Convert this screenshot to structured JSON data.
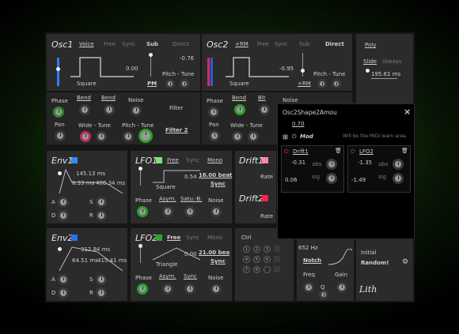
{
  "osc1": {
    "title": "Osc1",
    "voice": "Voice",
    "free": "Free",
    "sync": "Sync",
    "sub": "Sub",
    "direct": "Direct",
    "wave": "Square",
    "val": "0.00",
    "tune": "-0.76",
    "pitch_tune": "Pitch - Tune",
    "pm": "PM",
    "phase": "Phase",
    "bend1": "Bend",
    "bend2": "Bend",
    "noise": "Noise",
    "pan": "Pan",
    "wide_tune": "Wide - Tune",
    "pitch_tune2": "Pitch - Tune",
    "filter": "Filter",
    "filter2": "Filter 2"
  },
  "osc2": {
    "title": "Osc2",
    "rm": "+RM",
    "free": "Free",
    "sync": "Sync",
    "sub": "Sub",
    "direct": "Direct",
    "wave": "Square",
    "val": "-0.95",
    "pitch_tune": "Pitch - Tune",
    "rm2": "+RM",
    "phase": "Phase",
    "bend": "Bend",
    "bit": "Bit",
    "noise": "Noise",
    "pan": "Pan",
    "wide_tune": "Wide - Tune"
  },
  "poly": {
    "poly": "Poly",
    "slide": "Slide",
    "always": "Always",
    "time": "195.61 ms"
  },
  "env1": {
    "title": "Env1",
    "a_time": "145.13 ms",
    "d_time": "8.33 ms",
    "r_time": "406.34 ms",
    "a": "A",
    "s": "S",
    "d": "D",
    "r": "R"
  },
  "env2": {
    "title": "Env2",
    "a_time": "312.84 ms",
    "d_time": "64.51 ms",
    "r_time": "415.41 ms",
    "a": "A",
    "s": "S",
    "d": "D",
    "r": "R"
  },
  "lfo1": {
    "title": "LFO1",
    "free": "Free",
    "sync": "Sync",
    "mono": "Mono",
    "val": "0.54",
    "rate": "16.00 beat",
    "sync2": "Sync",
    "wave": "Square",
    "phase": "Phase",
    "asym": "Asym.",
    "satu": "Satu.-B.",
    "noise": "Noise"
  },
  "lfo2": {
    "title": "LFO2",
    "free": "Free",
    "sync": "Sync",
    "mono": "Mono",
    "val": "0.00",
    "rate": "21.00 bea",
    "sync2": "Sync",
    "wave": "Triangle",
    "phase": "Phase",
    "asym": "Asym.",
    "sync3": "Sync",
    "noise": "Noise"
  },
  "drift": {
    "d1": "Drift1",
    "d2": "Drift2",
    "rate1": "Rate",
    "rate2": "Rate"
  },
  "ctrl": {
    "title": "Ctrl",
    "cells": [
      "1",
      "2",
      "3",
      "4",
      "5",
      "6",
      "7",
      "8"
    ]
  },
  "filter": {
    "freq_val": "652 Hz",
    "notch": "Notch",
    "freq": "Freq",
    "q": "Q",
    "gain": "Gain"
  },
  "misc": {
    "initial": "Initial",
    "random": "Random!",
    "logo": "Lith"
  },
  "overlay": {
    "title": "Osc2Shape2Amou",
    "close": "×",
    "value": "0.70",
    "mod": "Mod",
    "midi_hint": "Will be the MIDI learn area.",
    "src1": "Drift1",
    "src2": "LFO2",
    "v1": "-0.31",
    "v2": "-1.35",
    "abs1": "abs",
    "abs2": "abs",
    "sig1": "sig",
    "sig2": "sig",
    "n1": "0.06",
    "n2": "-1.49"
  },
  "colors": {
    "env1": "#2a8ff0",
    "env2": "#2a6ff0",
    "lfo1": "#7ee07a",
    "lfo2": "#28a828",
    "drift1": "#ff8aa0",
    "drift2": "#ff1f4a",
    "accent": "#ff2a2a"
  }
}
